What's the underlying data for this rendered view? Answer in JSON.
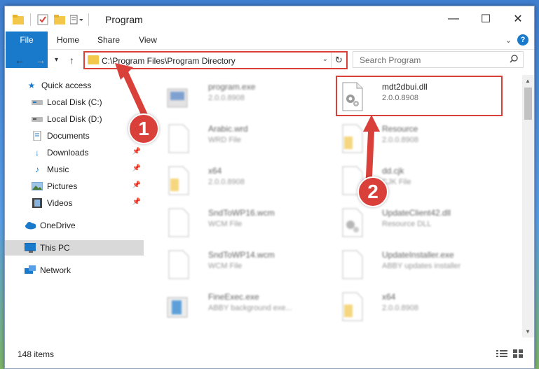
{
  "window": {
    "title": "Program",
    "controls": {
      "minimize": "—",
      "maximize": "☐",
      "close": "✕"
    }
  },
  "ribbon": {
    "tabs": [
      {
        "label": "File"
      },
      {
        "label": "Home"
      },
      {
        "label": "Share"
      },
      {
        "label": "View"
      }
    ],
    "help": "?"
  },
  "address": {
    "path": "C:\\Program Files\\Program Directory",
    "search_placeholder": "Search Program"
  },
  "nav": {
    "items": [
      {
        "label": "Quick access",
        "icon": "star-icon"
      },
      {
        "label": "Local Disk (C:)",
        "icon": "drive-icon"
      },
      {
        "label": "Local Disk (D:)",
        "icon": "drive-icon"
      },
      {
        "label": "Documents",
        "icon": "documents-icon"
      },
      {
        "label": "Downloads",
        "icon": "downloads-icon"
      },
      {
        "label": "Music",
        "icon": "music-icon"
      },
      {
        "label": "Pictures",
        "icon": "pictures-icon"
      },
      {
        "label": "Videos",
        "icon": "videos-icon"
      },
      {
        "label": "OneDrive",
        "icon": "cloud-icon"
      },
      {
        "label": "This PC",
        "icon": "computer-icon"
      },
      {
        "label": "Network",
        "icon": "network-icon"
      }
    ]
  },
  "files": [
    {
      "name": "program.exe",
      "sub": "2.0.0.8908",
      "icon": "exe-icon"
    },
    {
      "name": "mdt2dbui.dll",
      "sub": "2.0.0.8908",
      "icon": "dll-gear-icon"
    },
    {
      "name": "Arabic.wrd",
      "sub": "WRD File",
      "icon": "blank-file-icon"
    },
    {
      "name": "Resource",
      "sub": "2.0.0.8908",
      "icon": "folder-file-icon"
    },
    {
      "name": "x64",
      "sub": "2.0.0.8908",
      "icon": "folder-file-icon"
    },
    {
      "name": "dd.cjk",
      "sub": "CJK File",
      "icon": "blank-file-icon"
    },
    {
      "name": "SndToWP16.wcm",
      "sub": "WCM File",
      "icon": "blank-file-icon"
    },
    {
      "name": "UpdateClient42.dll",
      "sub": "Resource DLL",
      "icon": "dll-gear-icon"
    },
    {
      "name": "SndToWP14.wcm",
      "sub": "WCM File",
      "icon": "blank-file-icon"
    },
    {
      "name": "UpdateInstaller.exe",
      "sub": "ABBY updates installer",
      "icon": "blank-file-icon"
    },
    {
      "name": "FineExec.exe",
      "sub": "ABBY background exe...",
      "icon": "exe-blue-icon"
    },
    {
      "name": "x64",
      "sub": "2.0.0.8908",
      "icon": "folder-file-icon"
    }
  ],
  "status": {
    "items": "148 items"
  },
  "callouts": [
    "1",
    "2"
  ]
}
